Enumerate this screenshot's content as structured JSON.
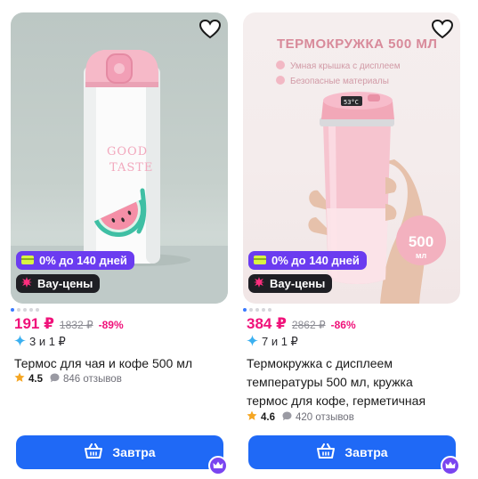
{
  "products": [
    {
      "installment_badge": "0% до 140 дней",
      "promo_badge": "Вау-цены",
      "price": "191 ₽",
      "old_price": "1832 ₽",
      "discount": "-89%",
      "installment": "3 и 1 ₽",
      "title": "Термос для чая и кофе 500 мл",
      "rating": "4.5",
      "reviews": "846 отзывов",
      "button_label": "Завтра",
      "image_text": [
        "GOOD",
        "TASTE"
      ]
    },
    {
      "installment_badge": "0% до 140 дней",
      "promo_badge": "Вау-цены",
      "price": "384 ₽",
      "old_price": "2862 ₽",
      "discount": "-86%",
      "installment": "7 и 1 ₽",
      "title": "Термокружка с дисплеем температуры 500 мл, кружка термос для кофе, герметичная",
      "rating": "4.6",
      "reviews": "420 отзывов",
      "button_label": "Завтра",
      "image_text": {
        "heading": "ТЕРМОКРУЖКА 500 МЛ",
        "feature_1": "Умная крышка с дисплеем",
        "feature_2": "Безопасные материалы",
        "volume": "500",
        "unit": "мл",
        "display": "53°C"
      }
    }
  ],
  "colors": {
    "price": "#f0127a",
    "button": "#1f69f6",
    "installment_badge": "#6b3cf0",
    "promo_badge": "#1f1f24",
    "crown": "#7a45f0"
  },
  "icons": {
    "favorite": "heart-outline-icon",
    "installment_badge": "card-icon",
    "promo_badge": "burst-icon",
    "installment": "sparkle-icon",
    "rating": "star-icon",
    "reviews": "chat-bubble-icon",
    "button": "basket-icon",
    "corner": "crown-icon"
  }
}
